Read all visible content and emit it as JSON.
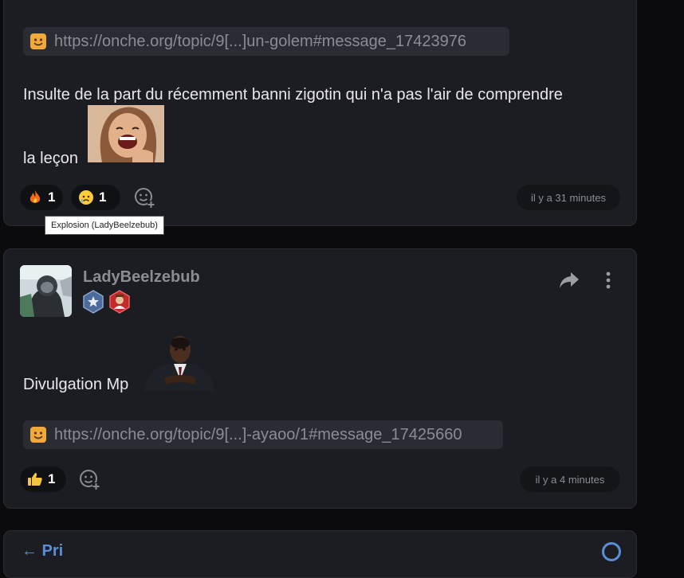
{
  "post1": {
    "link": "https://onche.org/topic/9[...]un-golem#message_17423976",
    "text_line1": "Insulte de la part du récemment banni zigotin qui n'a pas l'air de comprendre",
    "text_line2": "la leçon",
    "reactions": [
      {
        "icon": "fire-icon",
        "count": "1"
      },
      {
        "icon": "sad-face-icon",
        "count": "1"
      }
    ],
    "time": "il y a 31 minutes",
    "tooltip": "Explosion (LadyBeelzebub)"
  },
  "post2": {
    "username": "LadyBeelzebub",
    "text": "Divulgation Mp",
    "link": "https://onche.org/topic/9[...]-ayaoo/1#message_17425660",
    "reactions": [
      {
        "icon": "thumbs-up-icon",
        "count": "1"
      }
    ],
    "time": "il y a 4 minutes"
  },
  "post3": {
    "title_partial": "← Pri"
  },
  "colors": {
    "background": "#0b0b0d",
    "card": "#1c1d22",
    "link_box": "#2a2b33",
    "muted_text": "#8b8d96",
    "accent_blue": "#5a8fd8"
  }
}
